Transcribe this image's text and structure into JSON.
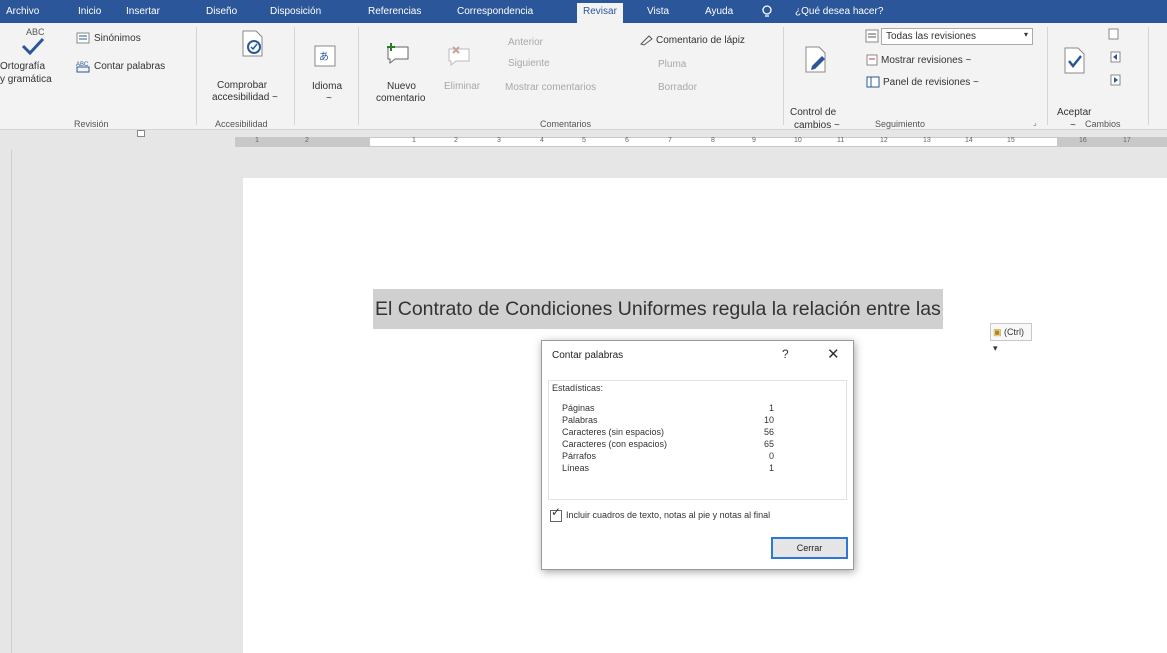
{
  "tabs": [
    "Archivo",
    "Inicio",
    "Insertar",
    "Diseño",
    "Disposición",
    "Referencias",
    "Correspondencia",
    "Revisar",
    "Vista",
    "Ayuda"
  ],
  "tell_me": "¿Qué desea hacer?",
  "revision": {
    "abc": "ABC",
    "spelling_1": "Ortografía",
    "spelling_2": "y gramática",
    "thesaurus": "Sinónimos",
    "word_count": "Contar palabras",
    "group": "Revisión"
  },
  "accessibility": {
    "line1": "Comprobar",
    "line2": "accesibilidad ~",
    "group": "Accesibilidad"
  },
  "language": {
    "label": "Idioma",
    "arrow": "~"
  },
  "comments": {
    "new_1": "Nuevo",
    "new_2": "comentario",
    "delete": "Eliminar",
    "previous": "Anterior",
    "next": "Siguiente",
    "show": "Mostrar comentarios",
    "pen_comment": "Comentario de lápiz",
    "ink": "Pluma",
    "eraser": "Borrador",
    "group": "Comentarios"
  },
  "tracking": {
    "track_1": "Control de",
    "track_2": "cambios ~",
    "all_markup": "Todas las revisiones",
    "show_markup": "Mostrar revisiones ~",
    "review_pane": "Panel de revisiones ~",
    "group": "Seguimiento"
  },
  "changes": {
    "accept": "Aceptar",
    "accept_arrow": "~",
    "group": "Cambios"
  },
  "ruler": [
    "1",
    "2",
    "1",
    "2",
    "3",
    "4",
    "5",
    "6",
    "7",
    "8",
    "9",
    "10",
    "11",
    "12",
    "13",
    "14",
    "15",
    "16",
    "17"
  ],
  "document": {
    "selected_text": "El Contrato de Condiciones Uniformes regula la relación entre las"
  },
  "paste_options": "(Ctrl) ▾",
  "dialog": {
    "title": "Contar palabras",
    "help": "?",
    "close": "✕",
    "stats_label": "Estadísticas:",
    "stats": [
      {
        "label": "Páginas",
        "value": "1"
      },
      {
        "label": "Palabras",
        "value": "10"
      },
      {
        "label": "Caracteres (sin espacios)",
        "value": "56"
      },
      {
        "label": "Caracteres (con espacios)",
        "value": "65"
      },
      {
        "label": "Párrafos",
        "value": "0"
      },
      {
        "label": "Líneas",
        "value": "1"
      }
    ],
    "checkbox_label": "Incluir cuadros de texto, notas al pie y notas al final",
    "checkbox_checked": true,
    "close_button": "Cerrar"
  },
  "colors": {
    "ribbon_blue": "#2b579a",
    "check_blue": "#2b78d6",
    "selection": "#d0d0d0"
  }
}
